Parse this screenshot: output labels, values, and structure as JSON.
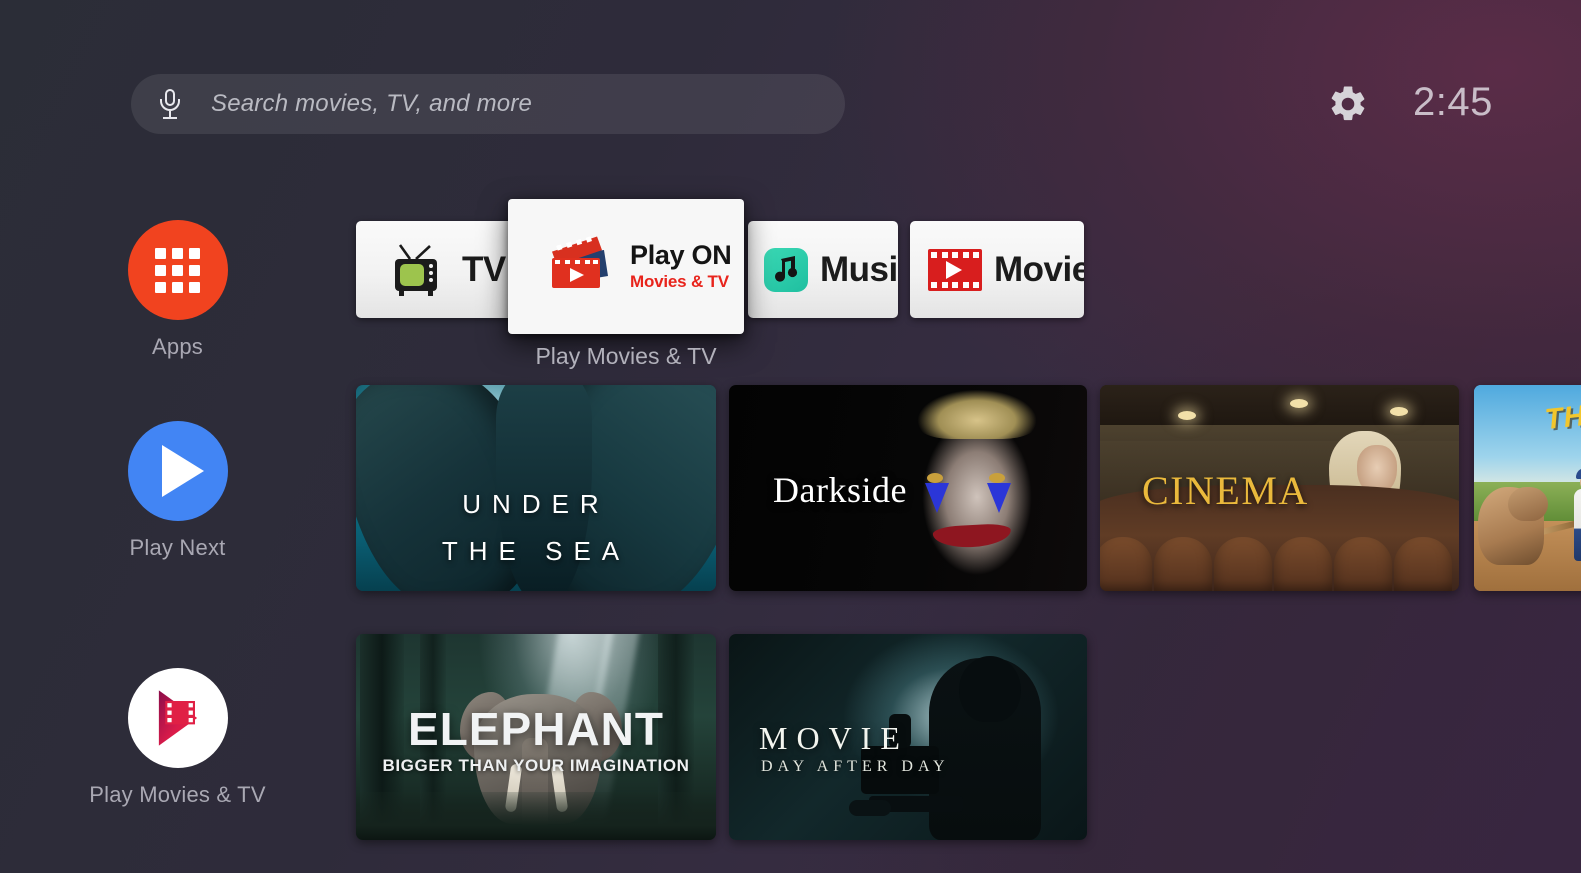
{
  "topbar": {
    "search": {
      "placeholder": "Search movies, TV, and more",
      "value": "",
      "mic_icon": "microphone-icon"
    },
    "settings_icon": "gear-icon",
    "clock": "2:45"
  },
  "rail": {
    "items": [
      {
        "label": "Apps",
        "icon": "apps-grid-icon",
        "color": "#f1431f"
      },
      {
        "label": "Play Next",
        "icon": "play-triangle-icon",
        "color": "#4285f4"
      },
      {
        "label": "Play Movies & TV",
        "icon": "play-movies-tv-icon",
        "color": "#ffffff"
      }
    ]
  },
  "app_row": {
    "focused_caption": "Play Movies & TV",
    "cards": [
      {
        "label": "TV",
        "icon": "retro-tv-icon",
        "focused": false
      },
      {
        "label": "Play ON",
        "sublabel": "Movies & TV",
        "icon": "clapperboard-icon",
        "focused": true
      },
      {
        "label": "Music",
        "icon": "music-note-icon",
        "focused": false
      },
      {
        "label": "Movie",
        "icon": "film-strip-play-icon",
        "focused": false
      }
    ]
  },
  "content": {
    "row1": [
      {
        "title": "UNDER",
        "title2": "THE SEA",
        "art": "underwater-rocks"
      },
      {
        "title": "Darkside",
        "art": "joker-face-portrait"
      },
      {
        "title": "CINEMA",
        "art": "theater-seats-woman"
      },
      {
        "title": "THE",
        "art": "baseball-field-dog"
      }
    ],
    "row2": [
      {
        "title": "ELEPHANT",
        "subtitle": "BIGGER THAN YOUR IMAGINATION",
        "art": "forest-elephant"
      },
      {
        "title": "MOVIE",
        "subtitle": "DAY AFTER DAY",
        "art": "cameraman-silhouette"
      }
    ]
  },
  "colors": {
    "accent_red": "#f1431f",
    "accent_blue": "#4285f4",
    "brand_red": "#e8241c",
    "music_teal": "#1fbfa0",
    "cinema_gold": "#eab93c",
    "background_left": "#2b2d37",
    "background_right": "#41294a"
  }
}
